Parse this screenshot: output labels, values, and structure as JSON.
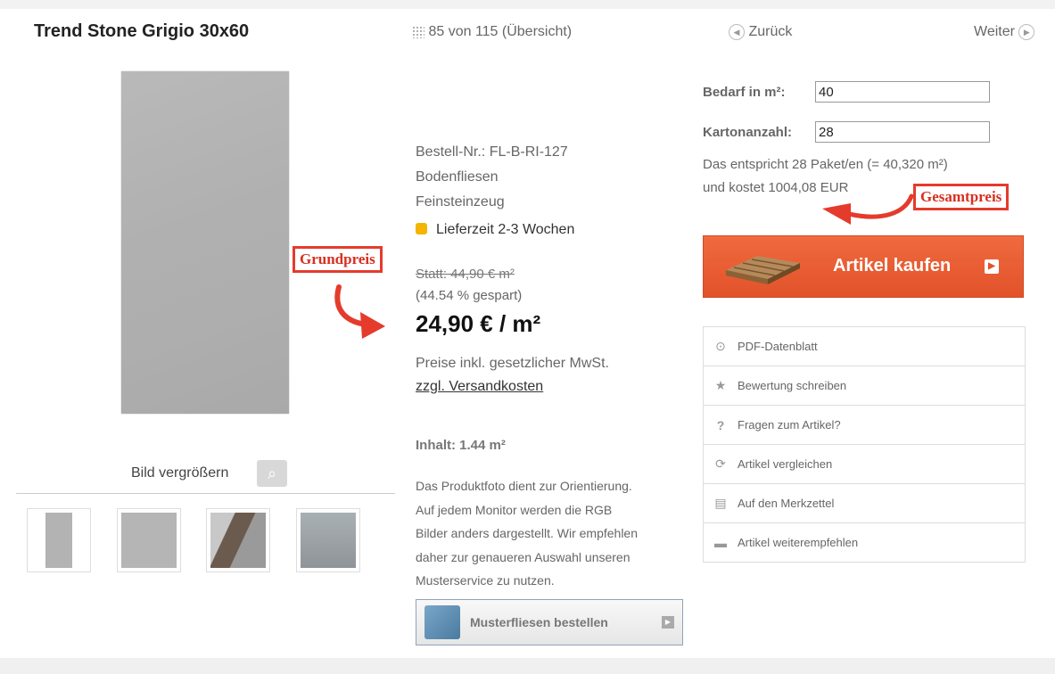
{
  "header": {
    "title": "Trend Stone Grigio 30x60",
    "overview": "85 von 115 (Übersicht)",
    "back": "Zurück",
    "next": "Weiter"
  },
  "gallery": {
    "zoom_label": "Bild vergrößern"
  },
  "product": {
    "order_no": "Bestell-Nr.: FL-B-RI-127",
    "category": "Bodenfliesen",
    "material": "Feinsteinzeug",
    "delivery": "Lieferzeit 2-3 Wochen",
    "old_price": "Statt: 44,90 € m²",
    "saving": "(44.54 % gespart)",
    "price": "24,90 € / m²",
    "tax_note": "Preise inkl. gesetzlicher MwSt.",
    "shipping_link": "zzgl. Versandkosten",
    "content": "Inhalt: 1.44 m²",
    "disclaimer": [
      "Das Produktfoto dient zur Orientierung.",
      "Auf jedem Monitor werden die RGB",
      "Bilder anders dargestellt. Wir empfehlen",
      "daher zur genaueren Auswahl unseren",
      "Musterservice zu nutzen."
    ],
    "sample_button": "Musterfliesen bestellen"
  },
  "calculator": {
    "need_label": "Bedarf in m²:",
    "need_value": "40",
    "cartons_label": "Kartonanzahl:",
    "cartons_value": "28",
    "summary1": "Das entspricht 28 Paket/en (= 40,320 m²)",
    "summary2": "und kostet 1004,08 EUR",
    "buy_button": "Artikel kaufen"
  },
  "actions": [
    {
      "label": "PDF-Datenblatt",
      "icon": "play-circle-icon"
    },
    {
      "label": "Bewertung schreiben",
      "icon": "star-icon"
    },
    {
      "label": "Fragen zum Artikel?",
      "icon": "question-icon"
    },
    {
      "label": "Artikel vergleichen",
      "icon": "refresh-icon"
    },
    {
      "label": "Auf den Merkzettel",
      "icon": "notepad-icon"
    },
    {
      "label": "Artikel weiterempfehlen",
      "icon": "chat-icon"
    }
  ],
  "annotations": {
    "base_price": "Grundpreis",
    "total_price": "Gesamtpreis"
  },
  "colors": {
    "accent": "#e2522a",
    "annotation": "#e53b2c",
    "delivery_dot": "#f4b400"
  }
}
